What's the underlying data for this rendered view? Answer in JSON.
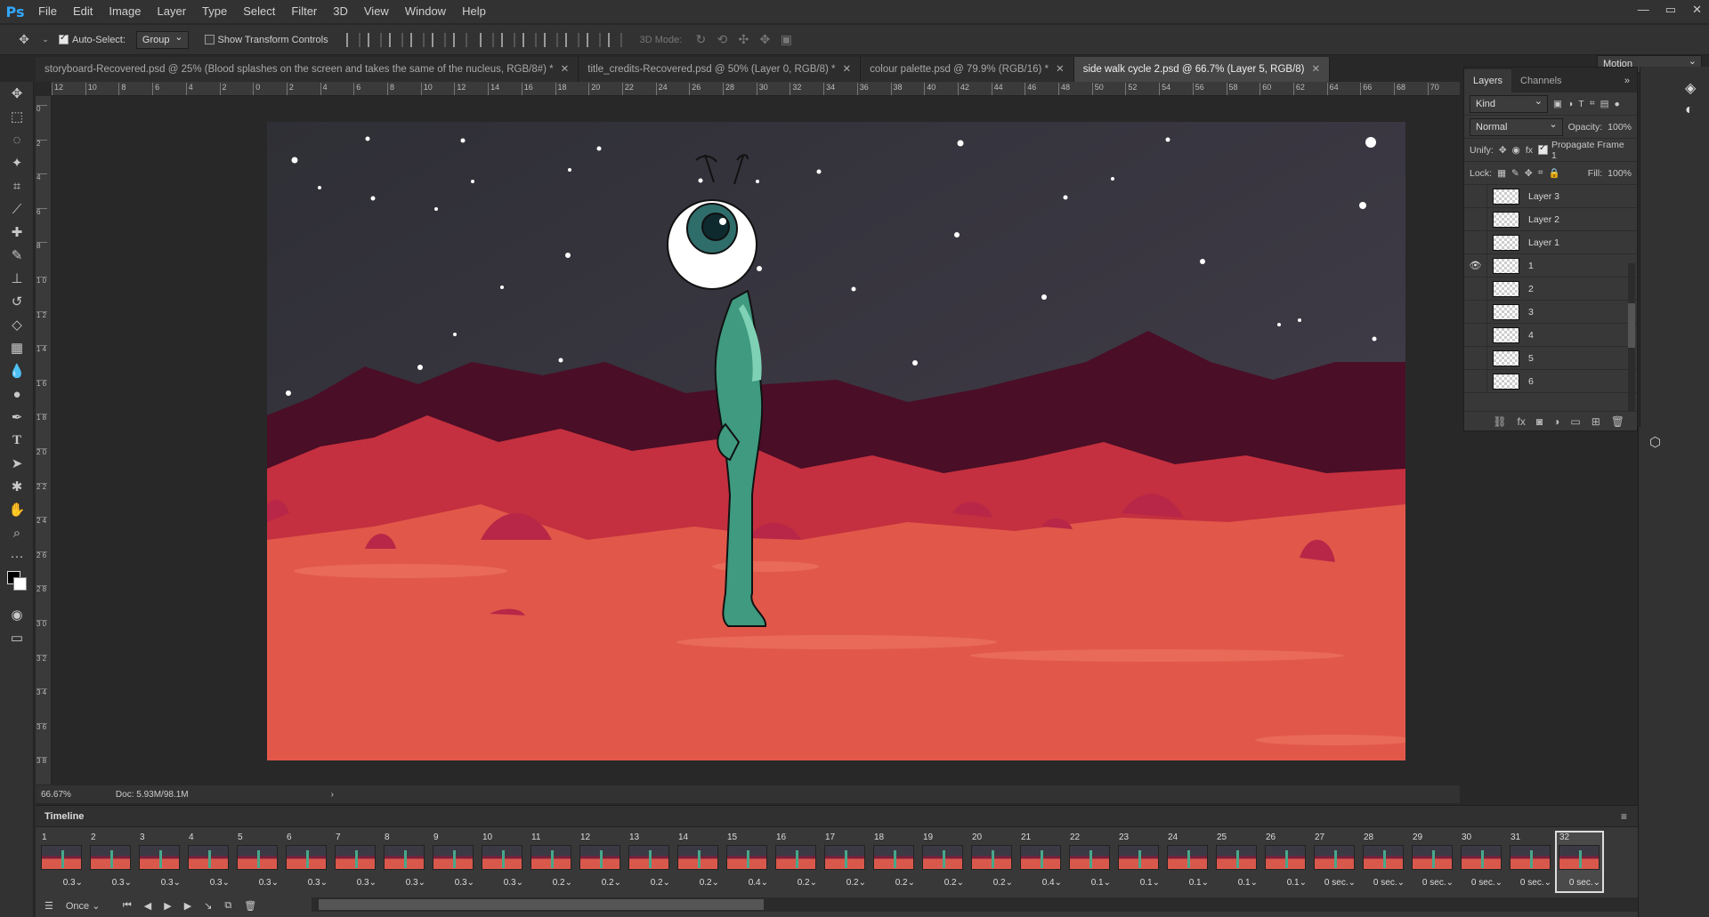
{
  "app": {
    "logo": "Ps"
  },
  "menu": [
    "File",
    "Edit",
    "Image",
    "Layer",
    "Type",
    "Select",
    "Filter",
    "3D",
    "View",
    "Window",
    "Help"
  ],
  "window_controls": [
    "—",
    "▭",
    "✕"
  ],
  "options": {
    "auto_select_label": "Auto-Select:",
    "auto_select_value": "Group",
    "show_transform_label": "Show Transform Controls",
    "mode_3d_label": "3D Mode:",
    "workspace": "Motion"
  },
  "tabs": [
    {
      "label": "storyboard-Recovered.psd @ 25% (Blood splashes on the screen and takes the same of the  nucleus, RGB/8#) *",
      "active": false
    },
    {
      "label": "title_credits-Recovered.psd @ 50% (Layer 0, RGB/8) *",
      "active": false
    },
    {
      "label": "colour palette.psd @ 79.9% (RGB/16) *",
      "active": false
    },
    {
      "label": "side walk cycle 2.psd @ 66.7% (Layer 5, RGB/8)",
      "active": true
    }
  ],
  "ruler_h": [
    "12",
    "10",
    "8",
    "6",
    "4",
    "2",
    "0",
    "2",
    "4",
    "6",
    "8",
    "10",
    "12",
    "14",
    "16",
    "18",
    "20",
    "22",
    "24",
    "26",
    "28",
    "30",
    "32",
    "34",
    "36",
    "38",
    "40",
    "42",
    "44",
    "46",
    "48",
    "50",
    "52",
    "54",
    "56",
    "58",
    "60",
    "62",
    "64",
    "66",
    "68",
    "70"
  ],
  "ruler_v": [
    "0",
    "2",
    "4",
    "6",
    "8",
    "1 0",
    "1 2",
    "1 4",
    "1 6",
    "1 8",
    "2 0",
    "2 2",
    "2 4",
    "2 6",
    "2 8",
    "3 0",
    "3 2",
    "3 4",
    "3 6",
    "3 8"
  ],
  "status": {
    "zoom": "66.67%",
    "doc": "Doc: 5.93M/98.1M"
  },
  "layers_panel": {
    "tabs": [
      "Layers",
      "Channels"
    ],
    "kind": "Kind",
    "blend": "Normal",
    "opacity_label": "Opacity:",
    "opacity": "100%",
    "unify_label": "Unify:",
    "propagate_label": "Propagate Frame 1",
    "lock_label": "Lock:",
    "fill_label": "Fill:",
    "fill": "100%",
    "layers": [
      {
        "name": "Layer 3",
        "visible": false
      },
      {
        "name": "Layer 2",
        "visible": false
      },
      {
        "name": "Layer 1",
        "visible": false
      },
      {
        "name": "1",
        "visible": true
      },
      {
        "name": "2",
        "visible": false
      },
      {
        "name": "3",
        "visible": false
      },
      {
        "name": "4",
        "visible": false
      },
      {
        "name": "5",
        "visible": false
      },
      {
        "name": "6",
        "visible": false
      }
    ]
  },
  "timeline": {
    "title": "Timeline",
    "loop": "Once",
    "frames": [
      {
        "n": "1",
        "t": "0.3"
      },
      {
        "n": "2",
        "t": "0.3"
      },
      {
        "n": "3",
        "t": "0.3"
      },
      {
        "n": "4",
        "t": "0.3"
      },
      {
        "n": "5",
        "t": "0.3"
      },
      {
        "n": "6",
        "t": "0.3"
      },
      {
        "n": "7",
        "t": "0.3"
      },
      {
        "n": "8",
        "t": "0.3"
      },
      {
        "n": "9",
        "t": "0.3"
      },
      {
        "n": "10",
        "t": "0.3"
      },
      {
        "n": "11",
        "t": "0.2"
      },
      {
        "n": "12",
        "t": "0.2"
      },
      {
        "n": "13",
        "t": "0.2"
      },
      {
        "n": "14",
        "t": "0.2"
      },
      {
        "n": "15",
        "t": "0.4"
      },
      {
        "n": "16",
        "t": "0.2"
      },
      {
        "n": "17",
        "t": "0.2"
      },
      {
        "n": "18",
        "t": "0.2"
      },
      {
        "n": "19",
        "t": "0.2"
      },
      {
        "n": "20",
        "t": "0.2"
      },
      {
        "n": "21",
        "t": "0.4"
      },
      {
        "n": "22",
        "t": "0.1"
      },
      {
        "n": "23",
        "t": "0.1"
      },
      {
        "n": "24",
        "t": "0.1"
      },
      {
        "n": "25",
        "t": "0.1"
      },
      {
        "n": "26",
        "t": "0.1"
      },
      {
        "n": "27",
        "t": "0 sec."
      },
      {
        "n": "28",
        "t": "0 sec."
      },
      {
        "n": "29",
        "t": "0 sec."
      },
      {
        "n": "30",
        "t": "0 sec."
      },
      {
        "n": "31",
        "t": "0 sec."
      },
      {
        "n": "32",
        "t": "0 sec."
      }
    ],
    "selected": "32"
  }
}
